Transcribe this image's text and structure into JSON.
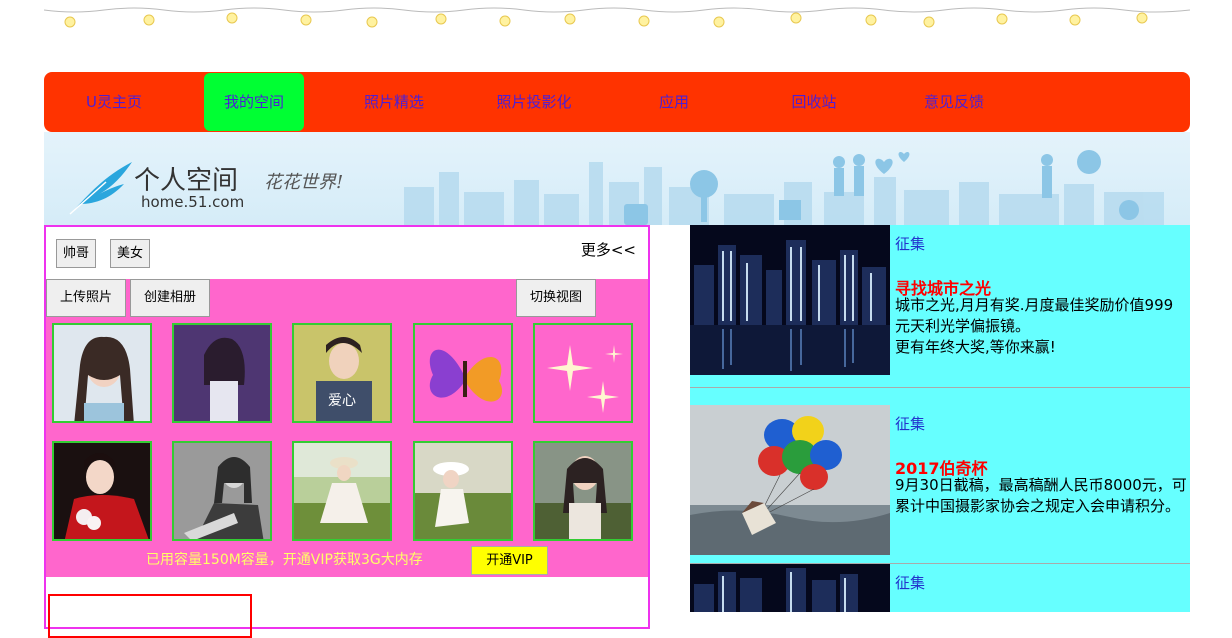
{
  "nav": {
    "items": [
      "U灵主页",
      "我的空间",
      "照片精选",
      "照片投影化",
      "应用",
      "回收站",
      "意见反馈"
    ],
    "active_index": 1
  },
  "banner": {
    "title": "个人空间",
    "url": "home.51.com",
    "slogan": "花花世界!"
  },
  "left": {
    "tags": [
      "帅哥",
      "美女"
    ],
    "more": "更多<<",
    "toolbar": {
      "upload": "上传照片",
      "create_album": "创建相册",
      "switch_view": "切换视图"
    },
    "storage_text": "已用容量150M容量，开通VIP获取3G大内存",
    "vip_button": "开通VIP"
  },
  "cards": [
    {
      "tag": "征集",
      "title": "寻找城市之光",
      "desc": "城市之光,月月有奖.月度最佳奖励价值999元天利光学偏振镜。\n更有年终大奖,等你来赢!"
    },
    {
      "tag": "征集",
      "title": "2017伯奇杯",
      "desc": "9月30日截稿，最高稿酬人民币8000元，可累计中国摄影家协会之规定入会申请积分。"
    },
    {
      "tag": "征集",
      "title": "",
      "desc": ""
    }
  ],
  "colors": {
    "nav_bg": "#ff3300",
    "nav_active": "#00ff33",
    "nav_text": "#4b1fd6",
    "panel_border": "#ee33ee",
    "pink": "#ff66cc",
    "card_bg": "#66ffff"
  }
}
